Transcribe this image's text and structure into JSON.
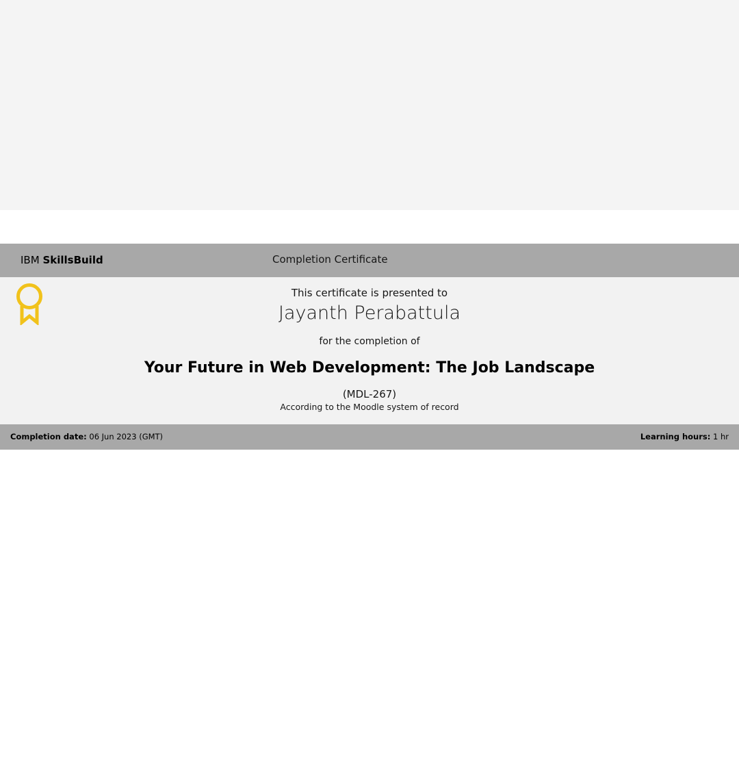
{
  "certificate": {
    "brand": {
      "prefix": "IBM",
      "name": "SkillsBuild"
    },
    "type_label": "Completion Certificate",
    "presented_to_text": "This certificate is presented to",
    "recipient_name": "Jayanth Perabattula",
    "completion_of_text": "for the completion of",
    "course_title": "Your Future in Web Development: The Job Landscape",
    "course_code": "(MDL-267)",
    "record_note": "According to the Moodle system of record",
    "badge_icon": "ribbon-award-icon",
    "footer": {
      "completion_date_label": "Completion date:",
      "completion_date_value": "06 Jun 2023 (GMT)",
      "learning_hours_label": "Learning hours:",
      "learning_hours_value": "1 hr"
    }
  },
  "colors": {
    "page_top_band": "#f4f4f4",
    "header_bar": "#a8a8a8",
    "body_panel": "#f2f2f2",
    "ribbon": "#f1c21b"
  }
}
